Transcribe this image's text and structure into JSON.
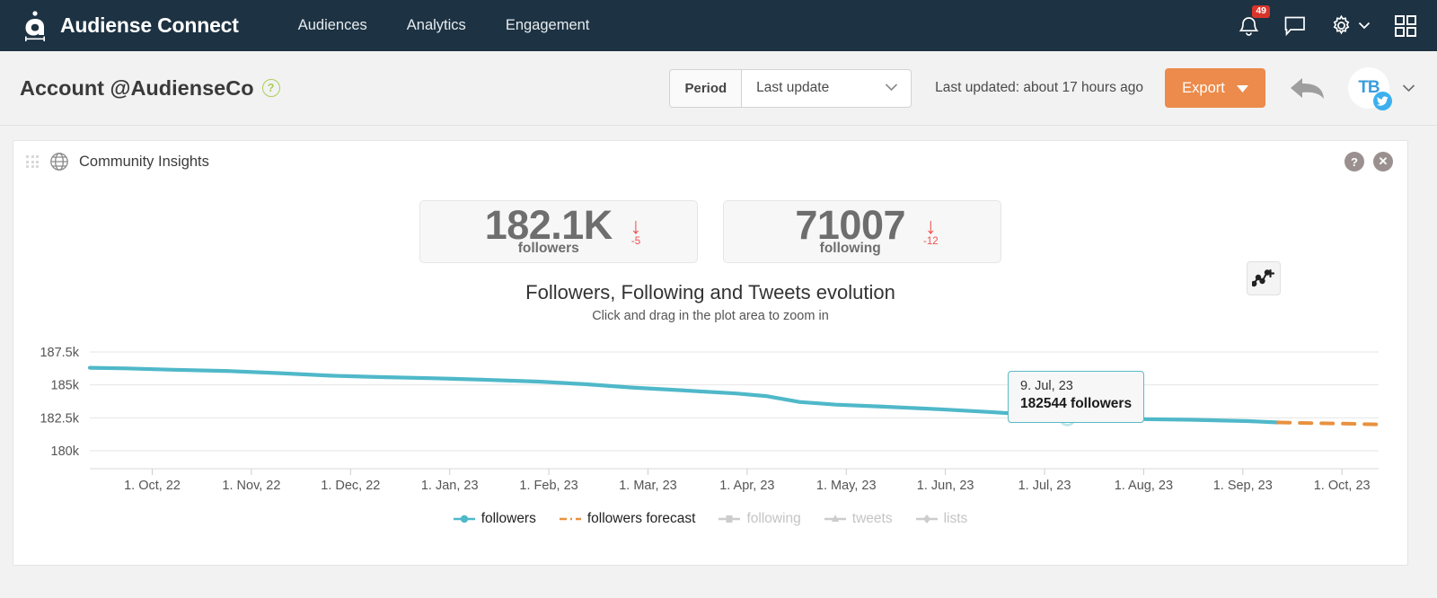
{
  "topnav": {
    "brand": "Audiense Connect",
    "links": [
      {
        "label": "Audiences"
      },
      {
        "label": "Analytics"
      },
      {
        "label": "Engagement"
      }
    ],
    "notifications_badge": "49",
    "icons": [
      "bell-icon",
      "chat-icon",
      "gear-icon",
      "apps-grid-icon"
    ],
    "bg_color": "#1d3242"
  },
  "subheader": {
    "account_title": "Account @AudienseCo",
    "help_glyph": "?",
    "period_label": "Period",
    "period_value": "Last update",
    "last_updated": "Last updated: about 17 hours ago",
    "export_label": "Export",
    "avatar_initials": "TB",
    "accent_color": "#ec8b4b"
  },
  "card": {
    "title": "Community Insights",
    "help_glyph": "?",
    "close_glyph": "✕",
    "kpis": [
      {
        "value": "182.1K",
        "label": "followers",
        "delta": "-5",
        "direction": "down"
      },
      {
        "value": "71007",
        "label": "following",
        "delta": "-12",
        "direction": "down"
      }
    ]
  },
  "chart_data": {
    "type": "line",
    "title": "Followers, Following and Tweets evolution",
    "subtitle": "Click and drag in the plot area to zoom in",
    "xlabel": "",
    "ylabel": "",
    "grid": true,
    "legend_position": "bottom",
    "ylim": [
      180000,
      187500
    ],
    "ytick_labels": [
      "187.5k",
      "185k",
      "182.5k",
      "180k"
    ],
    "ytick_values": [
      187500,
      185000,
      182500,
      180000
    ],
    "xtick_labels": [
      "1. Oct, 22",
      "1. Nov, 22",
      "1. Dec, 22",
      "1. Jan, 23",
      "1. Feb, 23",
      "1. Mar, 23",
      "1. Apr, 23",
      "1. May, 23",
      "1. Jun, 23",
      "1. Jul, 23",
      "1. Aug, 23",
      "1. Sep, 23",
      "1. Oct, 23"
    ],
    "series": [
      {
        "name": "followers",
        "color": "#4fb8c9",
        "style": "solid",
        "enabled": true,
        "x": [
          "2022-09-20",
          "2022-10-01",
          "2022-10-15",
          "2022-11-01",
          "2022-11-15",
          "2022-12-01",
          "2022-12-15",
          "2023-01-01",
          "2023-01-15",
          "2023-02-01",
          "2023-02-15",
          "2023-03-01",
          "2023-03-15",
          "2023-04-01",
          "2023-04-10",
          "2023-04-20",
          "2023-05-01",
          "2023-05-15",
          "2023-06-01",
          "2023-06-15",
          "2023-07-01",
          "2023-07-09",
          "2023-07-20",
          "2023-08-01",
          "2023-08-15",
          "2023-09-01",
          "2023-09-10"
        ],
        "values": [
          186300,
          186250,
          186150,
          186050,
          185900,
          185700,
          185600,
          185500,
          185400,
          185250,
          185050,
          184800,
          184600,
          184350,
          184150,
          183700,
          183500,
          183350,
          183150,
          182950,
          182700,
          182544,
          182450,
          182400,
          182350,
          182250,
          182150
        ]
      },
      {
        "name": "followers forecast",
        "color": "#e8913f",
        "style": "dashed",
        "enabled": true,
        "x": [
          "2023-09-10",
          "2023-09-20",
          "2023-10-01",
          "2023-10-10"
        ],
        "values": [
          182150,
          182100,
          182050,
          182000
        ]
      },
      {
        "name": "following",
        "color": "#cccccc",
        "style": "solid",
        "enabled": false,
        "values": []
      },
      {
        "name": "tweets",
        "color": "#cccccc",
        "style": "solid",
        "enabled": false,
        "values": []
      },
      {
        "name": "lists",
        "color": "#cccccc",
        "style": "solid",
        "enabled": false,
        "values": []
      }
    ],
    "tooltip": {
      "date": "9. Jul, 23",
      "value": "182544 followers",
      "point_x": 1180,
      "point_y": 490
    },
    "legend": [
      {
        "label": "followers",
        "state": "active"
      },
      {
        "label": "followers forecast",
        "state": "active"
      },
      {
        "label": "following",
        "state": "disabled"
      },
      {
        "label": "tweets",
        "state": "disabled"
      },
      {
        "label": "lists",
        "state": "disabled"
      }
    ]
  }
}
